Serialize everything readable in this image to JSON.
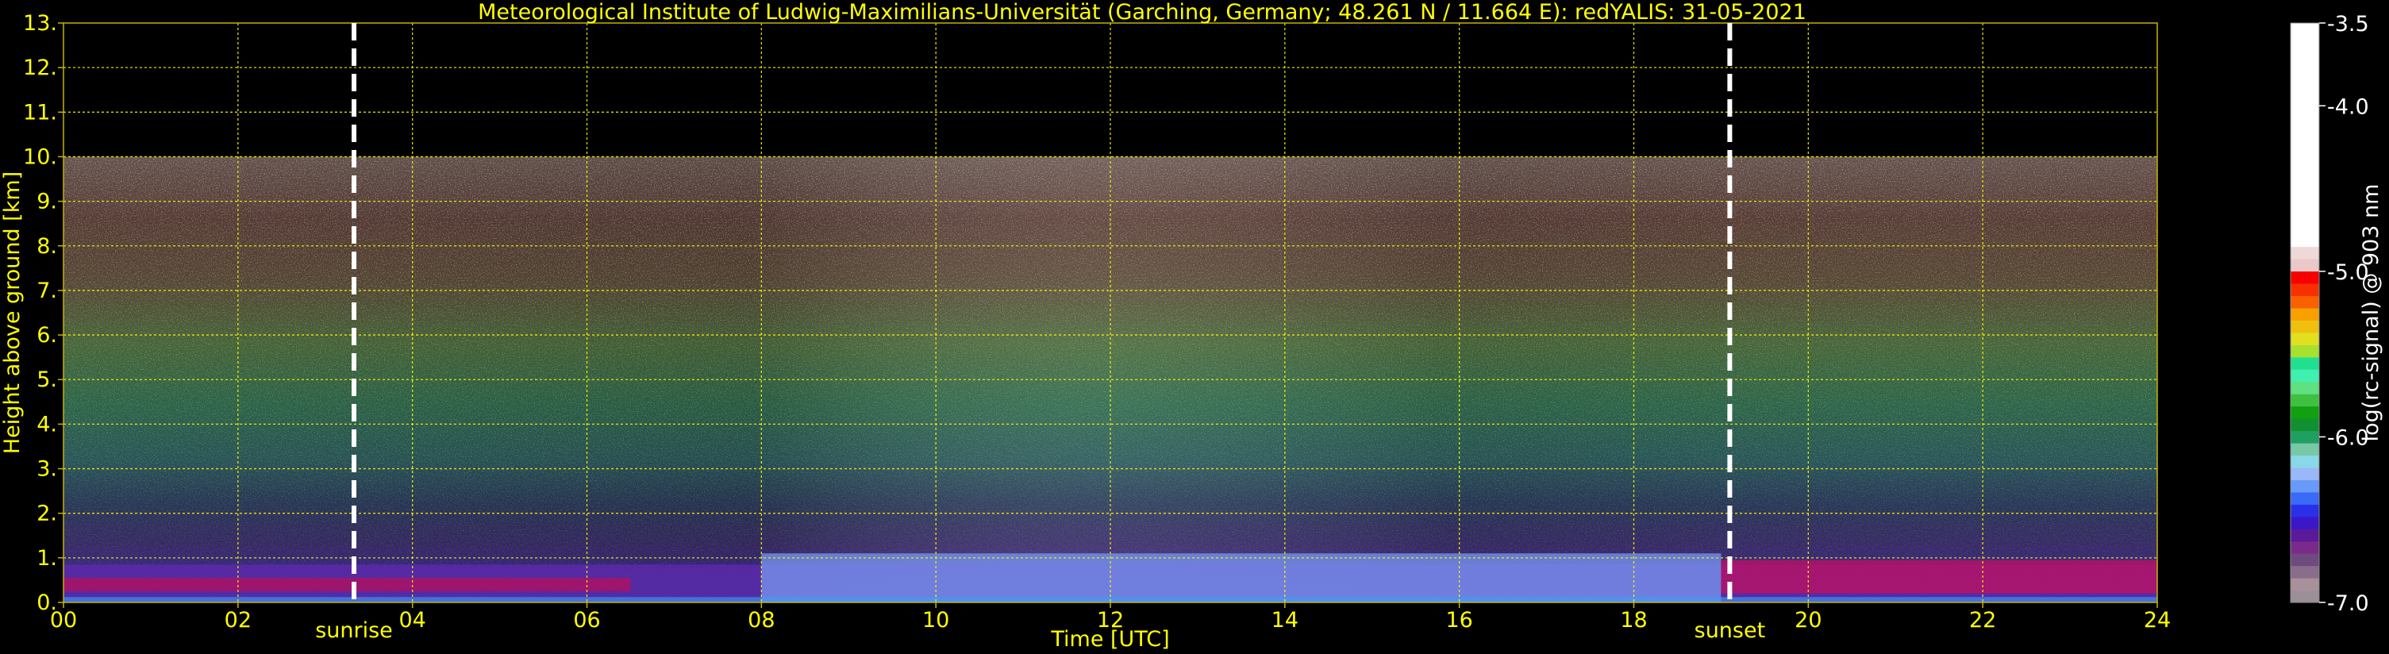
{
  "chart_data": {
    "type": "heatmap",
    "title": "Meteorological Institute of Ludwig-Maximilians-Universität (Garching, Germany; 48.261 N / 11.664 E):    redYALIS: 31-05-2021",
    "xlabel": "Time [UTC]",
    "ylabel": "Height above ground [km]",
    "xlim": [
      0,
      24
    ],
    "ylim": [
      0,
      13
    ],
    "x_ticks": [
      "00",
      "02",
      "04",
      "06",
      "08",
      "10",
      "12",
      "14",
      "16",
      "18",
      "20",
      "22",
      "24"
    ],
    "y_ticks": [
      "0.",
      "1.",
      "2.",
      "3.",
      "4.",
      "5.",
      "6.",
      "7.",
      "8.",
      "9.",
      "10.",
      "11.",
      "12.",
      "13."
    ],
    "grid": true,
    "data_top_km": 10,
    "colorbar": {
      "label": "log(rc-signal) @ 903 nm",
      "range": [
        -7.0,
        -3.5
      ],
      "tick_values": [
        -3.5,
        -4.0,
        -5.0,
        -6.0,
        -7.0
      ],
      "tick_labels": [
        "-3.5",
        "-4.0",
        "-5.0",
        "-6.0",
        "-7.0"
      ],
      "colors": [
        "#9b8f98",
        "#a9919c",
        "#8a6d8a",
        "#6e4a7e",
        "#7a2a8a",
        "#5a1a9a",
        "#3a18c8",
        "#2a30e8",
        "#3a6af8",
        "#6a9af8",
        "#9ab8f8",
        "#88d8e8",
        "#78c8a8",
        "#20a060",
        "#109030",
        "#10a010",
        "#40c040",
        "#60e080",
        "#40f0b0",
        "#20e090",
        "#a8e030",
        "#e0e020",
        "#f0c010",
        "#f8a000",
        "#f86000",
        "#f83000",
        "#f80000",
        "#e8c8c8",
        "#f0d8d8",
        "#ffffff"
      ]
    },
    "annotations": [
      {
        "text": "sunrise",
        "x": 3.33
      },
      {
        "text": "sunset",
        "x": 19.1
      }
    ]
  }
}
